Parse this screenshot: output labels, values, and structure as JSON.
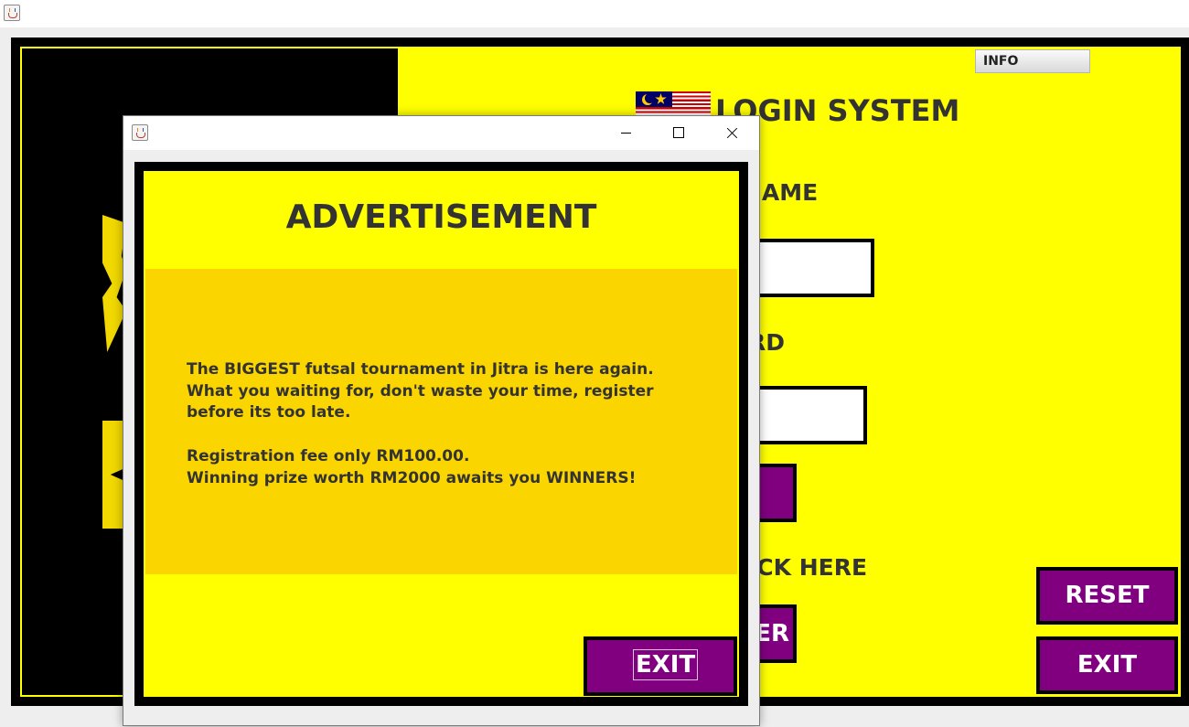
{
  "main_window": {
    "info_button": "INFO",
    "title": "LOGIN SYSTEM",
    "username_label_visible": "NAME",
    "password_label_visible": "RD",
    "register_prompt_visible": "ICK HERE",
    "register_button_visible": "ER",
    "reset_button": "RESET",
    "exit_button": "EXIT"
  },
  "ad_dialog": {
    "heading": "ADVERTISEMENT",
    "lines": [
      "The BIGGEST futsal tournament in Jitra is here again.",
      "What you waiting for, don't waste your time, register",
      "before its too late.",
      "Registration fee only RM100.00.",
      "Winning prize worth RM2000 awaits you WINNERS!"
    ],
    "exit_button": "EXIT"
  },
  "colors": {
    "background_yellow": "#ffff00",
    "ad_box": "#fad500",
    "button_purple": "#800080",
    "text_dark": "#333333"
  },
  "icons": [
    "java-app-icon",
    "minimize-icon",
    "maximize-icon",
    "close-icon",
    "malaysia-flag-icon"
  ]
}
